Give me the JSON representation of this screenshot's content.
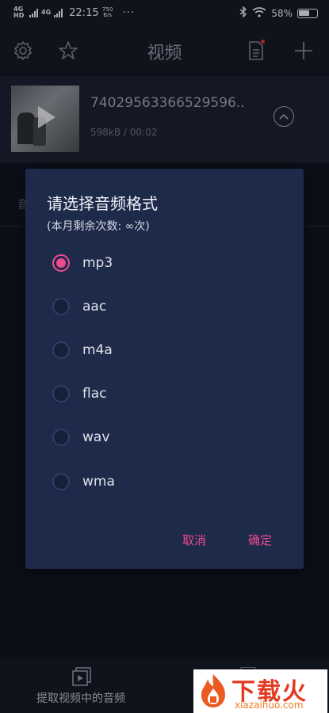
{
  "status_bar": {
    "network_1": "4G HD",
    "network_2": "4G",
    "time": "22:15",
    "speed": "750 B/s",
    "more": "···",
    "battery": "58%"
  },
  "header": {
    "title": "视频",
    "settings_icon": "gear-icon",
    "favorite_icon": "star-icon",
    "doc_icon": "document-icon",
    "add_icon": "plus-icon"
  },
  "video": {
    "title": "74029563366529596..",
    "meta": "598kB / 00:02"
  },
  "background": {
    "partial_label": "音"
  },
  "dialog": {
    "title": "请选择音频格式",
    "subtitle": "(本月剩余次数: ∞次)",
    "options": [
      {
        "label": "mp3",
        "selected": true
      },
      {
        "label": "aac",
        "selected": false
      },
      {
        "label": "m4a",
        "selected": false
      },
      {
        "label": "flac",
        "selected": false
      },
      {
        "label": "wav",
        "selected": false
      },
      {
        "label": "wma",
        "selected": false
      }
    ],
    "cancel_label": "取消",
    "ok_label": "确定"
  },
  "bottom_bar": {
    "extract_label": "提取视频中的音频"
  },
  "watermark": {
    "brand": "下载火",
    "url": "xiazaihuo.com"
  },
  "colors": {
    "accent": "#ee4b8f",
    "dialog_bg": "#1e2a4a",
    "page_bg": "#101521"
  }
}
